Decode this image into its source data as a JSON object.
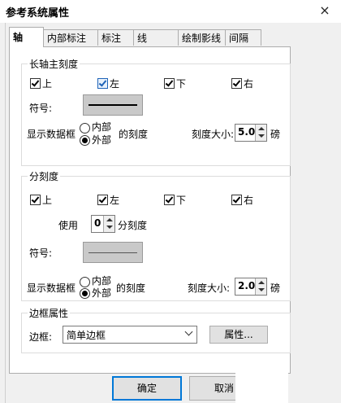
{
  "window": {
    "title": "参考系统属性",
    "close_glyph": "×"
  },
  "tabs": [
    "轴",
    "内部标注",
    "标注",
    "线",
    "绘制影线",
    "间隔"
  ],
  "major": {
    "legend": "长轴主刻度",
    "checks": [
      {
        "label": "上",
        "checked": true
      },
      {
        "label": "左",
        "checked": true
      },
      {
        "label": "下",
        "checked": true
      },
      {
        "label": "右",
        "checked": true
      }
    ],
    "symbol_label": "符号:",
    "display_label": "显示数据框",
    "radio_inner": "内部",
    "radio_outer": "外部",
    "ticks_suffix": "的刻度",
    "size_label": "刻度大小:",
    "size_value": "5.0",
    "unit": "磅"
  },
  "minor": {
    "legend": "分刻度",
    "checks": [
      {
        "label": "上",
        "checked": true
      },
      {
        "label": "左",
        "checked": true
      },
      {
        "label": "下",
        "checked": true
      },
      {
        "label": "右",
        "checked": true
      }
    ],
    "use_label": "使用",
    "use_value": "0",
    "use_suffix": "分刻度",
    "symbol_label": "符号:",
    "display_label": "显示数据框",
    "radio_inner": "内部",
    "radio_outer": "外部",
    "ticks_suffix": "的刻度",
    "size_label": "刻度大小:",
    "size_value": "2.0",
    "unit": "磅"
  },
  "border": {
    "legend": "边框属性",
    "label": "边框:",
    "select_value": "简单边框",
    "props_button": "属性..."
  },
  "footer": {
    "ok": "确定",
    "cancel": "取消"
  }
}
